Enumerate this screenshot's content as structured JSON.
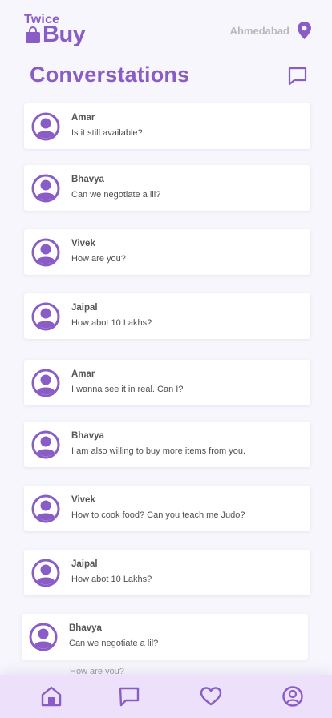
{
  "brand": {
    "line1": "Twice",
    "line2": "Buy",
    "color": "#8a5cc6"
  },
  "location": {
    "city": "Ahmedabad",
    "icon": "map-pin-icon"
  },
  "page": {
    "title": "Converstations",
    "new_chat_icon": "message-square-icon"
  },
  "conversations": [
    {
      "name": "Amar",
      "message": "Is it still available?"
    },
    {
      "name": "Bhavya",
      "message": "Can we negotiate a lil?"
    },
    {
      "name": "Vivek",
      "message": "How are you?"
    },
    {
      "name": "Jaipal",
      "message": "How abot 10 Lakhs?"
    },
    {
      "name": "Amar",
      "message": "I wanna see it in real. Can I?"
    },
    {
      "name": "Bhavya",
      "message": "I am also willing to buy more items from you."
    },
    {
      "name": "Vivek",
      "message": "How to cook food? Can you teach me Judo?"
    },
    {
      "name": "Jaipal",
      "message": "How abot 10 Lakhs?"
    },
    {
      "name": "Bhavya",
      "message": "Can we negotiate a lil?"
    }
  ],
  "partial_message": "How are you?",
  "bottom_nav": [
    {
      "label": "home",
      "icon": "home-icon"
    },
    {
      "label": "chats",
      "icon": "chat-icon"
    },
    {
      "label": "favorites",
      "icon": "heart-icon"
    },
    {
      "label": "profile",
      "icon": "user-circle-icon"
    }
  ]
}
